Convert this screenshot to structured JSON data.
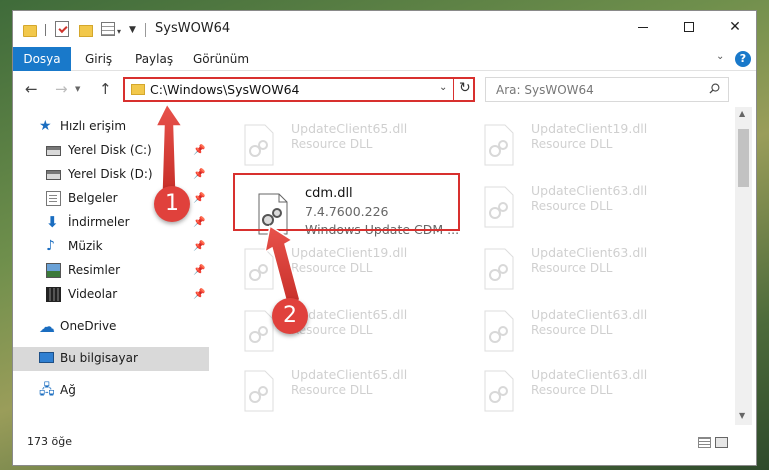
{
  "window": {
    "title": "SysWOW64"
  },
  "ribbon": {
    "tabs": [
      "Dosya",
      "Giriş",
      "Paylaş",
      "Görünüm"
    ]
  },
  "address": {
    "path": "C:\\Windows\\SysWOW64"
  },
  "search": {
    "placeholder": "Ara: SysWOW64"
  },
  "sidebar": {
    "quick_access": "Hızlı erişim",
    "items": [
      {
        "label": "Yerel Disk (C:)",
        "icon": "drive-icon"
      },
      {
        "label": "Yerel Disk (D:)",
        "icon": "drive-icon"
      },
      {
        "label": "Belgeler",
        "icon": "documents-icon"
      },
      {
        "label": "İndirmeler",
        "icon": "download-icon"
      },
      {
        "label": "Müzik",
        "icon": "music-icon"
      },
      {
        "label": "Resimler",
        "icon": "pictures-icon"
      },
      {
        "label": "Videolar",
        "icon": "videos-icon"
      }
    ],
    "onedrive": "OneDrive",
    "this_pc": "Bu bilgisayar",
    "network": "Ağ"
  },
  "files": {
    "left_col": [
      {
        "name": "UpdateClient65.dll",
        "desc": "Resource DLL"
      },
      {
        "name": "cdm.dll",
        "version": "7.4.7600.226",
        "desc": "Windows Update CDM ..."
      },
      {
        "name": "UpdateClient19.dll",
        "desc": "Resource DLL"
      },
      {
        "name": "UpdateClient65.dll",
        "desc": "Resource DLL"
      },
      {
        "name": "UpdateClient65.dll",
        "desc": "Resource DLL"
      }
    ],
    "right_col": [
      {
        "name": "UpdateClient19.dll",
        "desc": "Resource DLL"
      },
      {
        "name": "UpdateClient63.dll",
        "desc": "Resource DLL"
      },
      {
        "name": "UpdateClient63.dll",
        "desc": "Resource DLL"
      },
      {
        "name": "UpdateClient63.dll",
        "desc": "Resource DLL"
      },
      {
        "name": "UpdateClient63.dll",
        "desc": "Resource DLL"
      },
      {
        "name": "UpdateClient63.dll",
        "desc": "Resource DLL"
      }
    ]
  },
  "status": {
    "count": "173 öğe"
  },
  "annotations": {
    "badge1": "1",
    "badge2": "2",
    "accent": "#e0413c"
  }
}
